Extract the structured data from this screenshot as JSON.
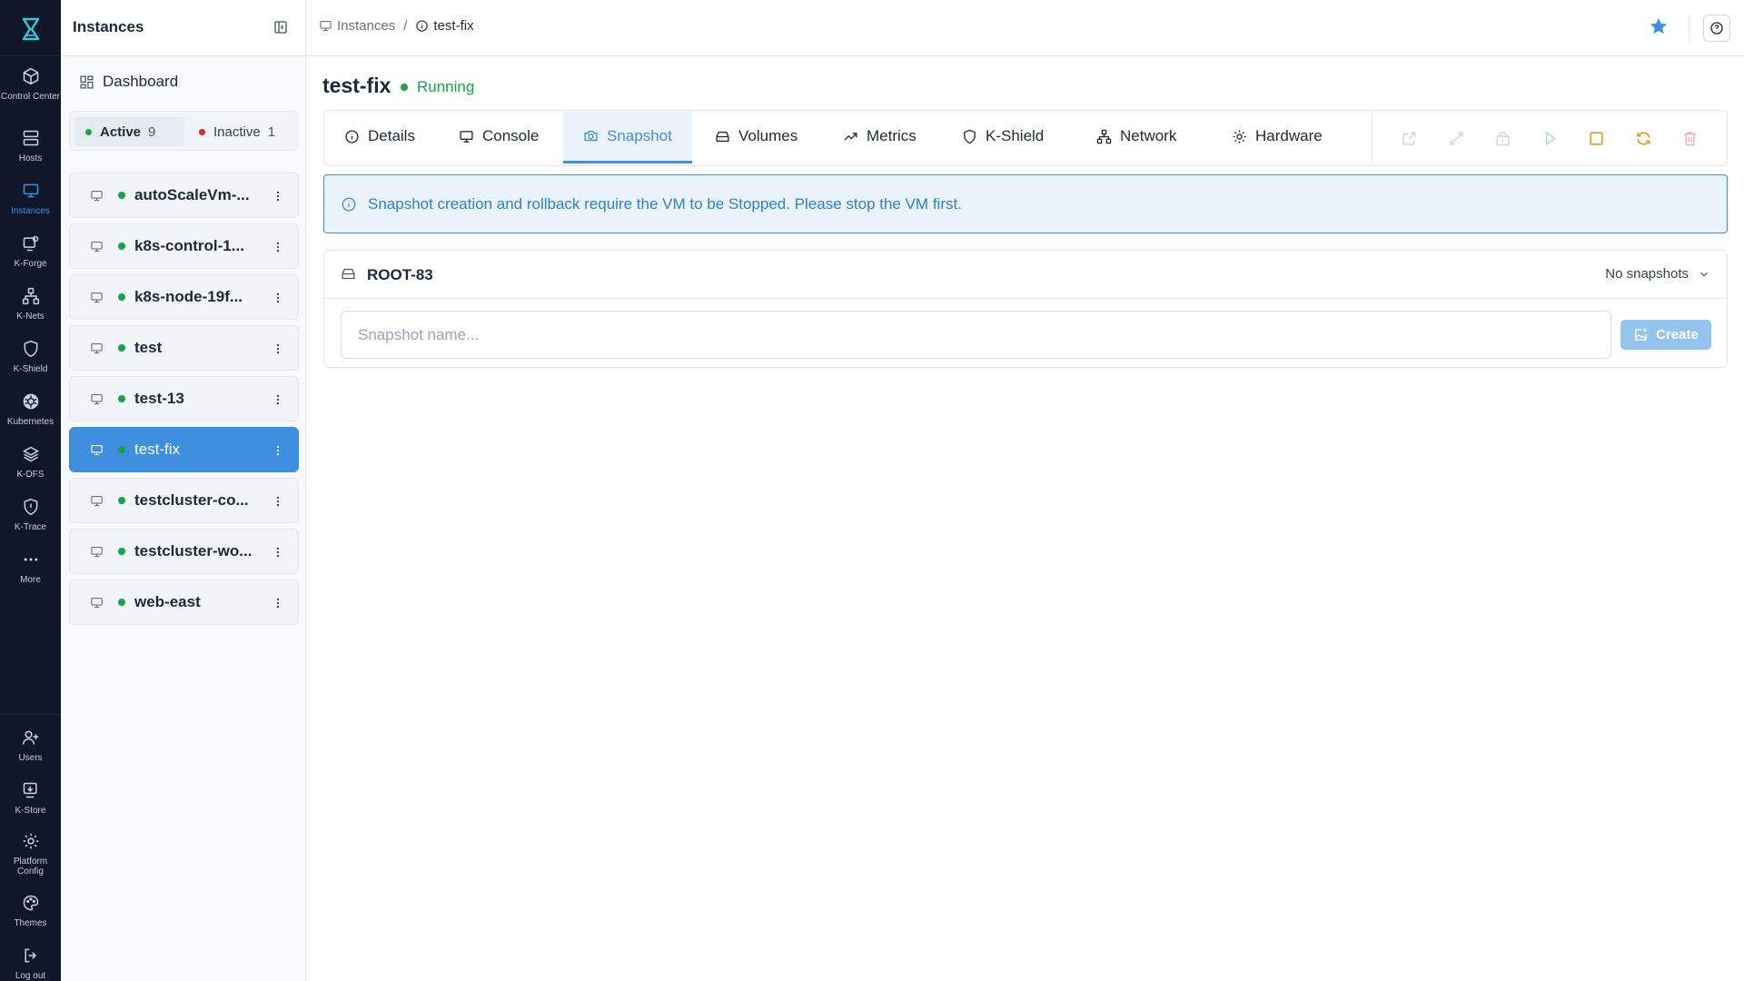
{
  "rail": {
    "top_items": [
      {
        "label": "Control Center",
        "icon": "cube-icon"
      },
      {
        "label": "Hosts",
        "icon": "server-icon"
      },
      {
        "label": "Instances",
        "icon": "monitor-icon"
      },
      {
        "label": "K-Forge",
        "icon": "forge-icon"
      },
      {
        "label": "K-Nets",
        "icon": "network-icon"
      },
      {
        "label": "K-Shield",
        "icon": "shield-icon"
      },
      {
        "label": "Kubernetes",
        "icon": "helm-icon"
      },
      {
        "label": "K-DFS",
        "icon": "layers-icon"
      },
      {
        "label": "K-Trace",
        "icon": "trace-shield-icon"
      },
      {
        "label": "More",
        "icon": "ellipsis-icon"
      }
    ],
    "bottom_items": [
      {
        "label": "Users",
        "icon": "users-icon"
      },
      {
        "label": "K-Store",
        "icon": "store-icon"
      },
      {
        "label": "Platform Config",
        "icon": "gear-icon"
      },
      {
        "label": "Themes",
        "icon": "palette-icon"
      },
      {
        "label": "Log out",
        "icon": "logout-icon"
      }
    ],
    "active": "Instances"
  },
  "panel": {
    "title": "Instances",
    "dashboard_label": "Dashboard",
    "filter": {
      "active_label": "Active",
      "active_count": "9",
      "inactive_label": "Inactive",
      "inactive_count": "1"
    },
    "instances": [
      "autoScaleVm-...",
      "k8s-control-1...",
      "k8s-node-19f...",
      "test",
      "test-13",
      "test-fix",
      "testcluster-co...",
      "testcluster-wo...",
      "web-east"
    ],
    "selected": "test-fix"
  },
  "topbar": {
    "crumb_root": "Instances",
    "crumb_sep": "/",
    "crumb_current": "test-fix"
  },
  "vm": {
    "name": "test-fix",
    "status": "Running"
  },
  "tabs": [
    {
      "label": "Details",
      "icon": "info-icon"
    },
    {
      "label": "Console",
      "icon": "monitor-icon"
    },
    {
      "label": "Snapshot",
      "icon": "camera-icon"
    },
    {
      "label": "Volumes",
      "icon": "disk-icon"
    },
    {
      "label": "Metrics",
      "icon": "trend-icon"
    },
    {
      "label": "K-Shield",
      "icon": "shield-icon"
    },
    {
      "label": "Network",
      "icon": "network-icon"
    },
    {
      "label": "Hardware",
      "icon": "gear-icon"
    }
  ],
  "active_tab": "Snapshot",
  "alert": {
    "text": "Snapshot creation and rollback require the VM to be Stopped. Please stop the VM first."
  },
  "volume": {
    "name": "ROOT-83",
    "snapshot_select": "No snapshots",
    "input_placeholder": "Snapshot name...",
    "input_value": "",
    "create_label": "Create"
  },
  "colors": {
    "accent": "#3f8fe0",
    "running": "#16a34a",
    "stopped": "#dc2626",
    "rail_bg": "#0f1729",
    "warn": "#e69a1f"
  }
}
